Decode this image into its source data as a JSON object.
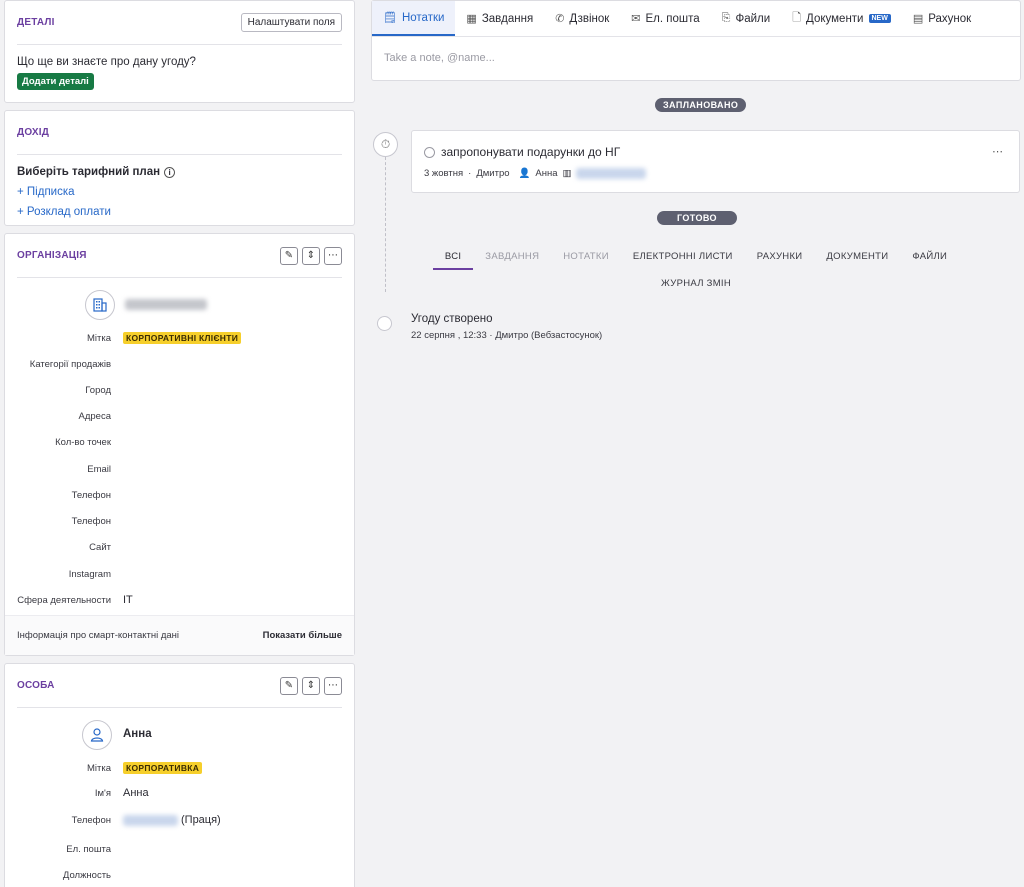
{
  "details": {
    "title": "ДЕТАЛІ",
    "configure_button": "Налаштувати поля",
    "question": "Що ще ви знаєте про дану угоду?",
    "add_button": "Додати деталі"
  },
  "income": {
    "title": "ДОХІД",
    "plan_label": "Виберіть тарифний план",
    "subscription_link": "+ Підписка",
    "schedule_link": "+ Розклад оплати"
  },
  "organization": {
    "title": "ОРГАНІЗАЦІЯ",
    "fields": [
      {
        "label": "Мітка",
        "tag": "КОРПОРАТИВНІ КЛІЄНТИ"
      },
      {
        "label": "Категорії продажів",
        "value": ""
      },
      {
        "label": "Город",
        "value": ""
      },
      {
        "label": "Адреса",
        "value": ""
      },
      {
        "label": "Кол-во точек",
        "value": ""
      },
      {
        "label": "Email",
        "value": ""
      },
      {
        "label": "Телефон",
        "value": ""
      },
      {
        "label": "Телефон",
        "value": ""
      },
      {
        "label": "Сайт",
        "value": ""
      },
      {
        "label": "Instagram",
        "value": ""
      },
      {
        "label": "Сфера деятельности",
        "value": "IT"
      }
    ],
    "smart_info": "Інформація про смарт-контактні дані",
    "show_more": "Показати більше"
  },
  "person": {
    "title": "ОСОБА",
    "name": "Анна",
    "fields": [
      {
        "label": "Мітка",
        "tag": "КОРПОРАТИВКА"
      },
      {
        "label": "Ім'я",
        "value": "Анна"
      },
      {
        "label": "Телефон",
        "value": "(Праця)"
      },
      {
        "label": "Ел. пошта",
        "value": ""
      },
      {
        "label": "Должность",
        "value": ""
      }
    ]
  },
  "composer": {
    "tabs": [
      {
        "label": "Нотатки",
        "icon": "note-icon",
        "glyph": "🗒"
      },
      {
        "label": "Завдання",
        "icon": "calendar-icon",
        "glyph": "▦"
      },
      {
        "label": "Дзвінок",
        "icon": "phone-icon",
        "glyph": "✆"
      },
      {
        "label": "Ел. пошта",
        "icon": "mail-icon",
        "glyph": "✉"
      },
      {
        "label": "Файли",
        "icon": "paperclip-icon",
        "glyph": "⎘"
      },
      {
        "label": "Документи",
        "icon": "document-icon",
        "glyph": "🗋",
        "badge": "NEW"
      },
      {
        "label": "Рахунок",
        "icon": "invoice-icon",
        "glyph": "▤"
      }
    ],
    "placeholder": "Take a note, @name..."
  },
  "scheduled": {
    "label": "ЗАПЛАНОВАНО",
    "task": {
      "title": "запропонувати подарунки до НГ",
      "date": "3 жовтня",
      "owner": "Дмитро",
      "person": "Анна"
    }
  },
  "done": {
    "label": "ГОТОВО",
    "filters": [
      "ВСІ",
      "ЗАВДАННЯ",
      "НОТАТКИ",
      "ЕЛЕКТРОННІ ЛИСТИ",
      "РАХУНКИ",
      "ДОКУМЕНТИ",
      "ФАЙЛИ"
    ],
    "filter_changelog": "ЖУРНАЛ ЗМІН",
    "created": {
      "title": "Угоду створено",
      "meta": "22 серпня , 12:33   ·  Дмитро (Вебзастосунок)"
    }
  }
}
